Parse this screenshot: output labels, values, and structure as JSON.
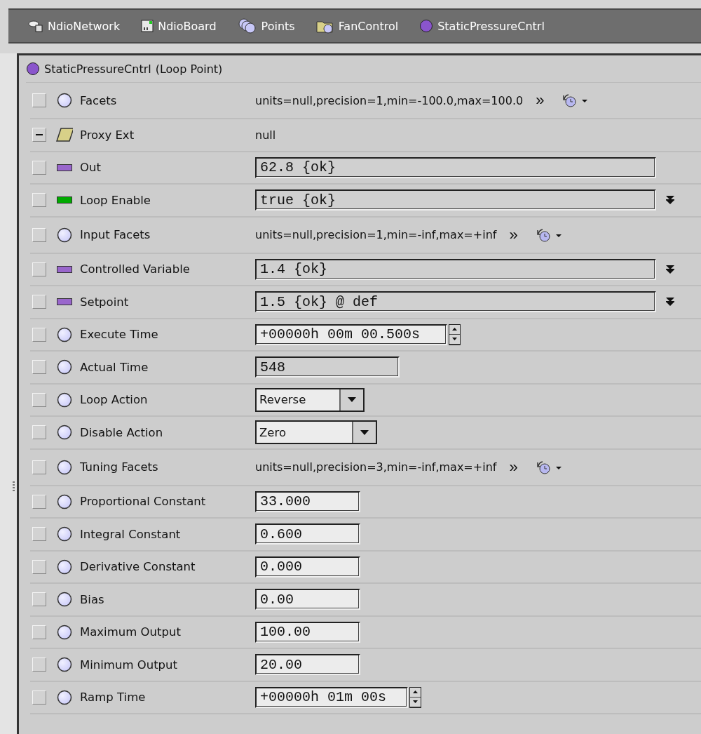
{
  "breadcrumb": [
    {
      "label": "NdioNetwork"
    },
    {
      "label": "NdioBoard"
    },
    {
      "label": "Points"
    },
    {
      "label": "FanControl"
    },
    {
      "label": "StaticPressureCntrl"
    }
  ],
  "header": {
    "name": "StaticPressureCntrl",
    "type": "(Loop Point)"
  },
  "rows": [
    {
      "label": "Facets",
      "expanded": false,
      "kind": "facets",
      "value": "units=null,precision=1,min=-100.0,max=100.0",
      "more": "»"
    },
    {
      "label": "Proxy Ext",
      "expanded": true,
      "kind": "text",
      "value": "null"
    },
    {
      "label": "Out",
      "color": "#9966cc",
      "expanded": false,
      "kind": "status",
      "value": "62.8 {ok}",
      "linked": false
    },
    {
      "label": "Loop Enable",
      "color": "#00aa00",
      "expanded": false,
      "kind": "status",
      "value": "true {ok}",
      "linked": true
    },
    {
      "label": "Input Facets",
      "expanded": false,
      "kind": "facets",
      "value": "units=null,precision=1,min=-inf,max=+inf",
      "more": "»"
    },
    {
      "label": "Controlled Variable",
      "color": "#9966cc",
      "expanded": false,
      "kind": "status",
      "value": "1.4 {ok}",
      "linked": true
    },
    {
      "label": "Setpoint",
      "color": "#9966cc",
      "expanded": false,
      "kind": "status",
      "value": "1.5 {ok} @ def",
      "linked": true
    },
    {
      "label": "Execute Time",
      "expanded": false,
      "kind": "time",
      "value": "+00000h 00m 00.500s"
    },
    {
      "label": "Actual Time",
      "expanded": false,
      "kind": "readout",
      "value": "548"
    },
    {
      "label": "Loop Action",
      "expanded": false,
      "kind": "select",
      "value": "Reverse"
    },
    {
      "label": "Disable Action",
      "expanded": false,
      "kind": "select",
      "value": "Zero"
    },
    {
      "label": "Tuning Facets",
      "expanded": false,
      "kind": "facets",
      "value": "units=null,precision=3,min=-inf,max=+inf",
      "more": "»"
    },
    {
      "label": "Proportional Constant",
      "expanded": false,
      "kind": "number",
      "value": "33.000"
    },
    {
      "label": "Integral Constant",
      "expanded": false,
      "kind": "number",
      "value": "0.600"
    },
    {
      "label": "Derivative Constant",
      "expanded": false,
      "kind": "number",
      "value": "0.000"
    },
    {
      "label": "Bias",
      "expanded": false,
      "kind": "number",
      "value": "0.00"
    },
    {
      "label": "Maximum Output",
      "expanded": false,
      "kind": "number",
      "value": "100.00"
    },
    {
      "label": "Minimum Output",
      "expanded": false,
      "kind": "number",
      "value": "20.00"
    },
    {
      "label": "Ramp Time",
      "expanded": false,
      "kind": "time",
      "value": "+00000h 01m 00s"
    }
  ]
}
